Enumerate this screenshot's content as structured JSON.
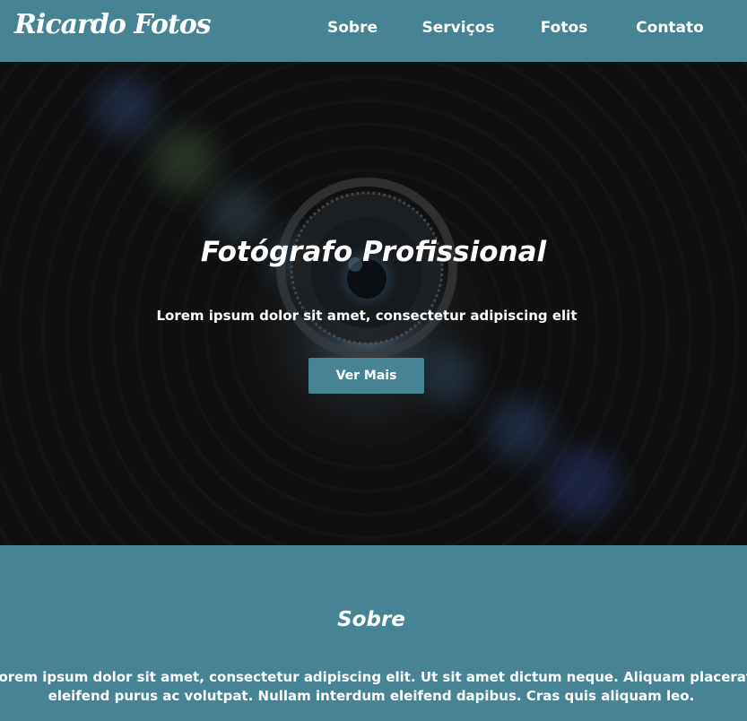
{
  "navbar": {
    "brand": "Ricardo Fotos",
    "links": [
      "Sobre",
      "Serviços",
      "Fotos",
      "Contato"
    ]
  },
  "hero": {
    "title": "Fotógrafo Profissional",
    "text": "Lorem ipsum dolor sit amet, consectetur adipiscing elit",
    "button_label": "Ver Mais"
  },
  "about": {
    "title": "Sobre",
    "text": "Lorem ipsum dolor sit amet, consectetur adipiscing elit. Ut sit amet dictum neque. Aliquam placerat eleifend purus ac volutpat. Nullam interdum eleifend dapibus. Cras quis aliquam leo."
  },
  "colors": {
    "primary": "#468393",
    "hero_background": "#0d0d0e",
    "text": "#ffffff"
  }
}
